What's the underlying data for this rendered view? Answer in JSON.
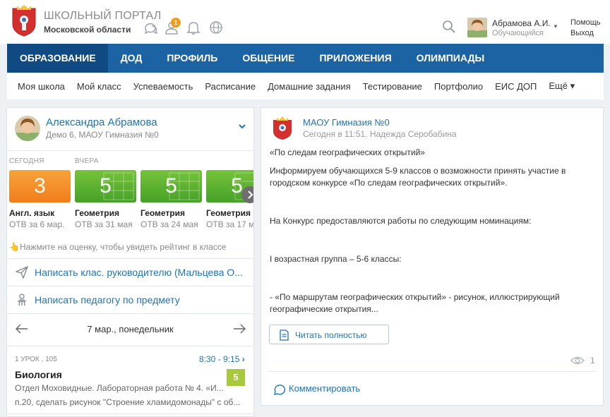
{
  "header": {
    "logo_title": "ШКОЛЬНЫЙ ПОРТАЛ",
    "logo_subtitle": "Московской области",
    "notification_badge": "1",
    "user_name": "Абрамова А.И.",
    "user_role": "Обучающийся",
    "help": "Помощь",
    "logout": "Выход",
    "icons": [
      "chat-icon",
      "contacts-icon",
      "bell-icon",
      "globe-icon",
      "search-icon"
    ]
  },
  "nav": {
    "items": [
      {
        "label": "ОБРАЗОВАНИЕ",
        "active": true
      },
      {
        "label": "ДОД",
        "active": false
      },
      {
        "label": "ПРОФИЛЬ",
        "active": false
      },
      {
        "label": "ОБЩЕНИЕ",
        "active": false
      },
      {
        "label": "ПРИЛОЖЕНИЯ",
        "active": false
      },
      {
        "label": "ОЛИМПИАДЫ",
        "active": false
      }
    ]
  },
  "subnav": {
    "items": [
      "Моя школа",
      "Мой класс",
      "Успеваемость",
      "Расписание",
      "Домашние задания",
      "Тестирование",
      "Портфолио",
      "ЕИС ДОП"
    ],
    "more": "Ещё ▾"
  },
  "profile": {
    "name": "Александра Абрамова",
    "subtitle": "Демо 6, МАОУ Гимназия №0"
  },
  "grades": {
    "today_label": "СЕГОДНЯ",
    "yesterday_label": "ВЧЕРА",
    "items": [
      {
        "value": "3",
        "subject": "Англ. язык",
        "date": "ОТВ за 6 мар.",
        "color": "#f39029"
      },
      {
        "value": "5",
        "subject": "Геометрия",
        "date": "ОТВ за 31 мая",
        "color": "#5fb331"
      },
      {
        "value": "5",
        "subject": "Геометрия",
        "date": "ОТВ за 24 мая",
        "color": "#5fb331"
      },
      {
        "value": "5",
        "subject": "Геометрия",
        "date": "ОТВ за 17 ма",
        "color": "#5fb331"
      }
    ],
    "hint": "Нажмите на оценку, чтобы увидеть рейтинг в классе"
  },
  "links": {
    "write_class_teacher": "Написать клас. руководителю (Мальцева О...",
    "write_subject_teacher": "Написать педагогу по предмету"
  },
  "schedule": {
    "date": "7 мар., понедельник",
    "lesson": {
      "number": "1 УРОК , 105",
      "time": "8:30 - 9:15",
      "title": "Биология",
      "mark": "5",
      "line1": "Отдел Моховидные. Лабораторная работа № 4. «И...",
      "line2": "п.20, сделать рисунок \"Строение хламидомонады\" с об..."
    }
  },
  "post": {
    "org": "МАОУ Гимназия №0",
    "meta": "Сегодня в 11:51. Надежда Серобабина",
    "title": "«По следам географических открытий»",
    "p1": "Информируем обучающихся 5-9 классов о возможности принять участие в городском конкурсе «По следам географических открытий».",
    "p2": "На Конкурс предоставляются работы по следующим номинациям:",
    "p3": "I возрастная  группа – 5-6  классы:",
    "p4": "- «По маршрутам географических открытий» - рисунок, иллюстрирующий географические открытия...",
    "read_more": "Читать полностью",
    "views": "1",
    "comment": "Комментировать"
  },
  "colors": {
    "nav_blue": "#1b63a3",
    "nav_active": "#0f4a82",
    "link_blue": "#1d74b8",
    "grade_orange": "#f39029",
    "grade_green": "#5fb331",
    "mark_green": "#a7c93b",
    "badge_orange": "#f29b1d"
  }
}
